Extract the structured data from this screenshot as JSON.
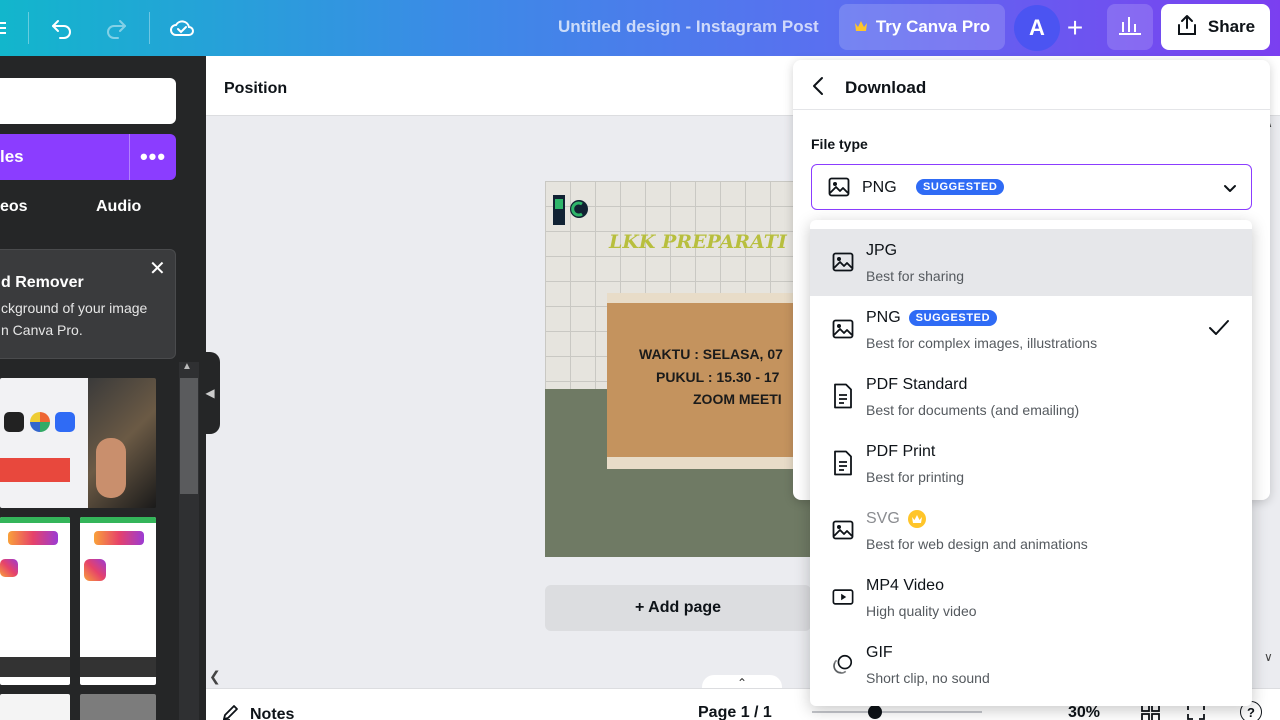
{
  "topbar": {
    "doc_title": "Untitled design - Instagram Post",
    "pro_label": "Try Canva Pro",
    "avatar_letter": "A",
    "share_label": "Share",
    "plus_label": "+"
  },
  "sidepanel": {
    "files_label": "les",
    "files_more": "•••",
    "tabs": [
      "eos",
      "Audio"
    ],
    "promo": {
      "title": "d Remover",
      "line1": "ckground of your image",
      "line2": "n Canva Pro.",
      "close": "✕"
    }
  },
  "editor": {
    "toolbar_label": "Position",
    "add_page_label": "+ Add page",
    "canvas": {
      "title": "LKK PREPARATI",
      "line1": "WAKTU : SELASA, 07",
      "line2": "PUKUL  : 15.30 - 17",
      "line3": "ZOOM MEETI"
    }
  },
  "footer": {
    "notes_label": "Notes",
    "page_count": "Page 1 / 1",
    "zoom": "30%",
    "help": "?"
  },
  "download": {
    "title": "Download",
    "file_type_label": "File type",
    "selected": {
      "name": "PNG",
      "badge": "SUGGESTED"
    },
    "options": [
      {
        "name": "JPG",
        "desc": "Best for sharing",
        "icon": "image-icon",
        "highlighted": true
      },
      {
        "name": "PNG",
        "badge": "SUGGESTED",
        "desc": "Best for complex images, illustrations",
        "icon": "image-icon",
        "checked": true
      },
      {
        "name": "PDF Standard",
        "desc": "Best for documents (and emailing)",
        "icon": "document-icon"
      },
      {
        "name": "PDF Print",
        "desc": "Best for printing",
        "icon": "document-icon"
      },
      {
        "name": "SVG",
        "desc": "Best for web design and animations",
        "icon": "image-icon",
        "pro": true
      },
      {
        "name": "MP4 Video",
        "desc": "High quality video",
        "icon": "video-icon"
      },
      {
        "name": "GIF",
        "desc": "Short clip, no sound",
        "icon": "gif-icon"
      }
    ]
  },
  "colors": {
    "accent_purple": "#8b3dff",
    "badge_blue": "#2f6bf5",
    "panel_dark": "#252627",
    "crown_gold": "#ffc529"
  }
}
